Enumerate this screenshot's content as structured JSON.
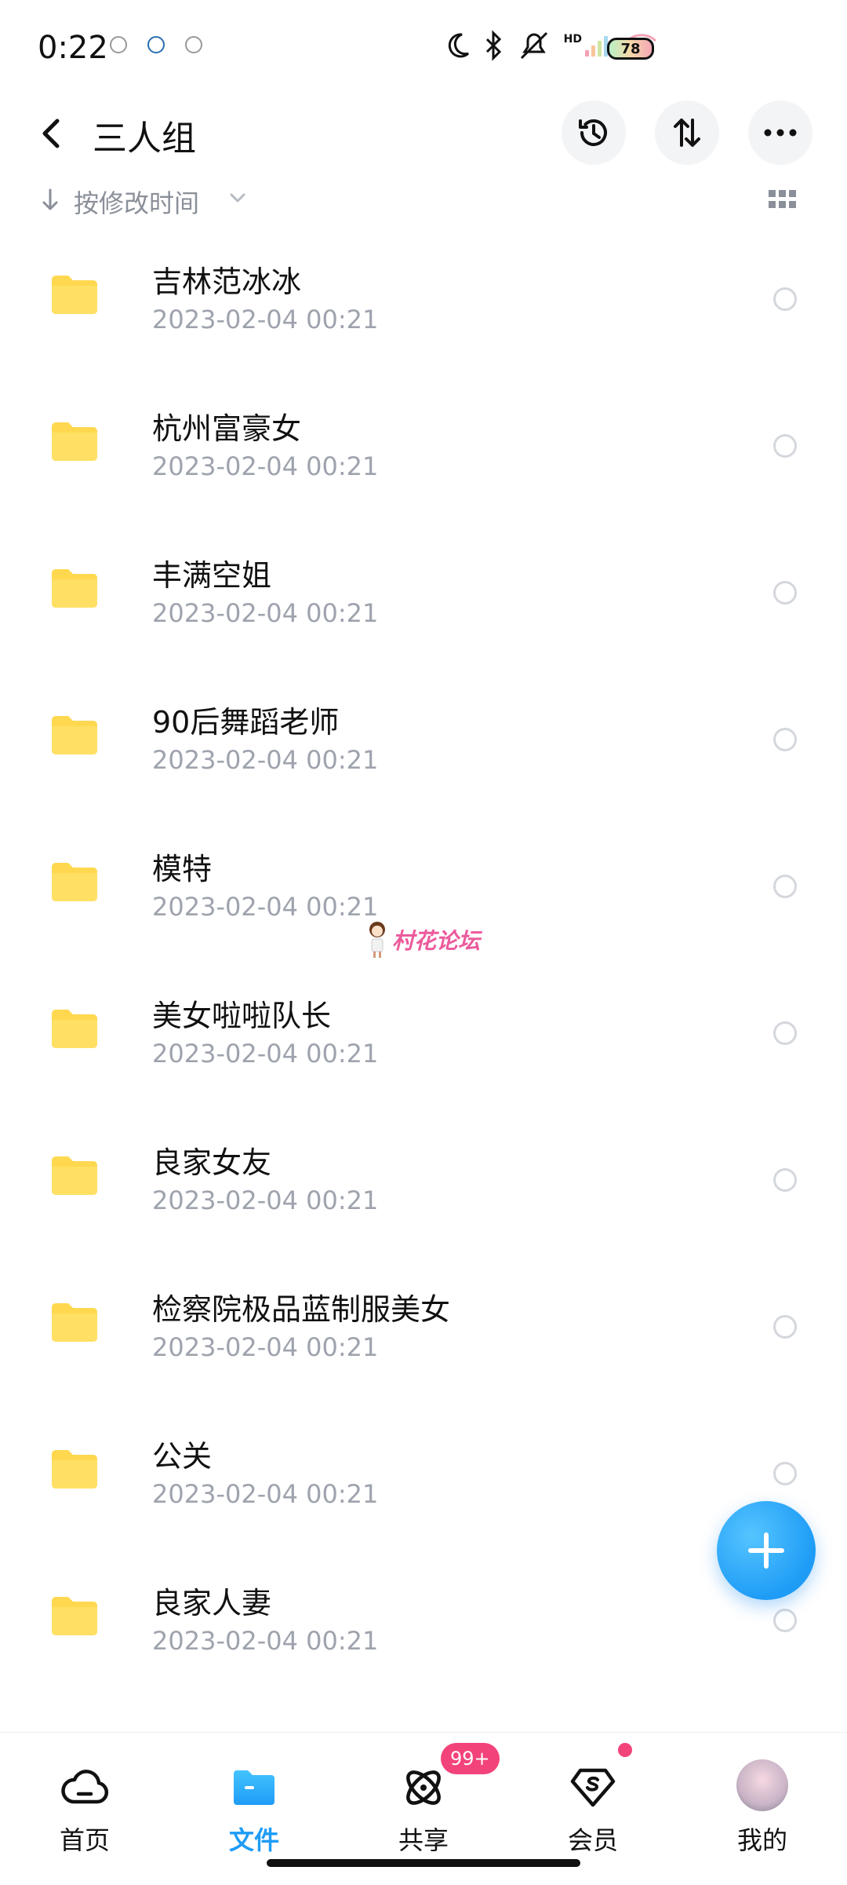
{
  "status_bar": {
    "time": "0:22",
    "battery": "78",
    "network": "HD"
  },
  "header": {
    "title": "三人组"
  },
  "sort": {
    "label": "按修改时间"
  },
  "folders": [
    {
      "name": "吉林范冰冰",
      "date": "2023-02-04  00:21"
    },
    {
      "name": "杭州富豪女",
      "date": "2023-02-04  00:21"
    },
    {
      "name": "丰满空姐",
      "date": "2023-02-04  00:21"
    },
    {
      "name": "90后舞蹈老师",
      "date": "2023-02-04  00:21"
    },
    {
      "name": "模特",
      "date": "2023-02-04  00:21"
    },
    {
      "name": "美女啦啦队长",
      "date": "2023-02-04  00:21"
    },
    {
      "name": "良家女友",
      "date": "2023-02-04  00:21"
    },
    {
      "name": "检察院极品蓝制服美女",
      "date": "2023-02-04  00:21"
    },
    {
      "name": "公关",
      "date": "2023-02-04  00:21"
    },
    {
      "name": "良家人妻",
      "date": "2023-02-04  00:21"
    }
  ],
  "watermark": "村花论坛",
  "tabs": [
    {
      "label": "首页",
      "icon": "cloud-icon"
    },
    {
      "label": "文件",
      "icon": "folder-icon"
    },
    {
      "label": "共享",
      "icon": "share-icon"
    },
    {
      "label": "会员",
      "icon": "vip-icon"
    },
    {
      "label": "我的",
      "icon": "avatar"
    }
  ],
  "share_badge": "99+",
  "colors": {
    "accent": "#1e9cf6",
    "folder": "#ffd84f",
    "badge": "#f2437a"
  }
}
